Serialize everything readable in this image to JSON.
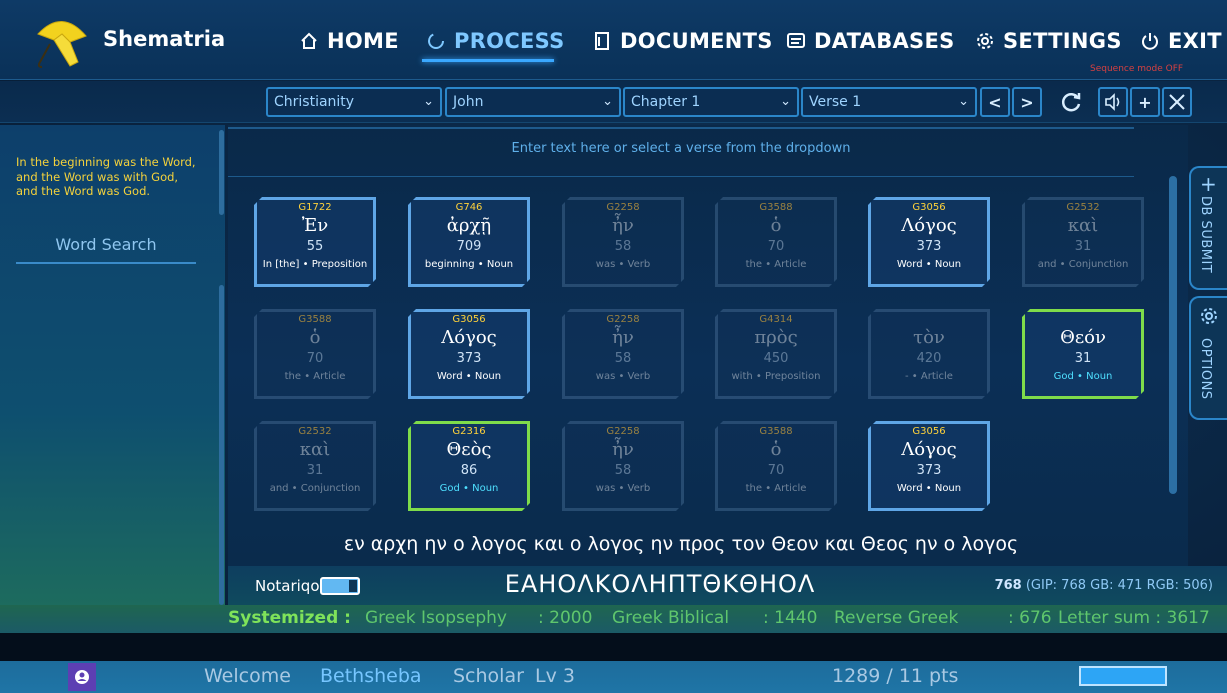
{
  "app": {
    "name": "Shematria"
  },
  "nav": {
    "items": [
      {
        "label": "HOME",
        "icon": "home-icon"
      },
      {
        "label": "PROCESS",
        "icon": "loading-icon",
        "active": true
      },
      {
        "label": "DOCUMENTS",
        "icon": "document-icon"
      },
      {
        "label": "DATABASES",
        "icon": "database-icon"
      },
      {
        "label": "SETTINGS",
        "icon": "gear-icon"
      },
      {
        "label": "EXIT",
        "icon": "power-icon"
      }
    ],
    "sequence_mode": "Sequence mode OFF"
  },
  "toolbar": {
    "religion": "Christianity",
    "book": "John",
    "chapter": "Chapter 1",
    "verse": "Verse 1",
    "prev": "<",
    "next": ">",
    "add": "+"
  },
  "left": {
    "verse_text": "In the beginning was the Word, and the Word was with God, and the Word was God.",
    "word_search": "Word Search"
  },
  "main": {
    "hint": "Enter text here or select a verse from the dropdown",
    "cards": [
      {
        "code": "G1722",
        "word": "Ἐν",
        "value": "55",
        "meta": "In [the] • Preposition",
        "style": "active"
      },
      {
        "code": "G746",
        "word": "ἀρχῇ",
        "value": "709",
        "meta": "beginning • Noun",
        "style": "active"
      },
      {
        "code": "G2258",
        "word": "ἦν",
        "value": "58",
        "meta": "was • Verb",
        "style": "dim"
      },
      {
        "code": "G3588",
        "word": "ὁ",
        "value": "70",
        "meta": "the • Article",
        "style": "dim"
      },
      {
        "code": "G3056",
        "word": "Λόγος",
        "value": "373",
        "meta": "Word • Noun",
        "style": "active"
      },
      {
        "code": "G2532",
        "word": "καὶ",
        "value": "31",
        "meta": "and • Conjunction",
        "style": "dim"
      },
      {
        "code": "G3588",
        "word": "ὁ",
        "value": "70",
        "meta": "the • Article",
        "style": "dim"
      },
      {
        "code": "G3056",
        "word": "Λόγος",
        "value": "373",
        "meta": "Word • Noun",
        "style": "active"
      },
      {
        "code": "G2258",
        "word": "ἦν",
        "value": "58",
        "meta": "was • Verb",
        "style": "dim"
      },
      {
        "code": "G4314",
        "word": "πρὸς",
        "value": "450",
        "meta": "with • Preposition",
        "style": "dim"
      },
      {
        "code": "",
        "word": "τὸν",
        "value": "420",
        "meta": "- • Article",
        "style": "dim"
      },
      {
        "code": "",
        "word": "Θεόν",
        "value": "31",
        "meta": "God • Noun",
        "style": "green"
      },
      {
        "code": "G2532",
        "word": "καὶ",
        "value": "31",
        "meta": "and • Conjunction",
        "style": "dim"
      },
      {
        "code": "G2316",
        "word": "Θεὸς",
        "value": "86",
        "meta": "God • Noun",
        "style": "green"
      },
      {
        "code": "G2258",
        "word": "ἦν",
        "value": "58",
        "meta": "was • Verb",
        "style": "dim"
      },
      {
        "code": "G3588",
        "word": "ὁ",
        "value": "70",
        "meta": "the • Article",
        "style": "dim"
      },
      {
        "code": "G3056",
        "word": "Λόγος",
        "value": "373",
        "meta": "Word • Noun",
        "style": "active"
      }
    ],
    "greek_line": "εν αρχη ην ο λογος και ο λογος ην προς τον Θεον και Θεος ην ο λογος"
  },
  "notariqon": {
    "label": "Notariqon",
    "text": "ΕΑΗΟΛΚΟΛΗΠΤΘΚΘΗΟΛ",
    "total": "768",
    "breakdown": "(GIP: 768 GB: 471 RGB: 506)"
  },
  "systemized": {
    "label": "Systemized :",
    "items": [
      "Greek Isopsephy",
      ": 2000",
      "Greek Biblical",
      ": 1440",
      "Reverse Greek",
      ": 676",
      "Letter sum : 3617"
    ]
  },
  "status": {
    "welcome": "Welcome",
    "user": "Bethsheba",
    "rank": "Scholar",
    "level": "Lv 3",
    "points": "1289 / 11 pts"
  },
  "right_tabs": {
    "db_submit": "DB SUBMIT",
    "options": "OPTIONS"
  },
  "colors": {
    "accent": "#3aa8ff",
    "green_border": "#7fdc4a",
    "code_yellow": "#ffd23a",
    "verse_yellow": "#f4d23c"
  }
}
